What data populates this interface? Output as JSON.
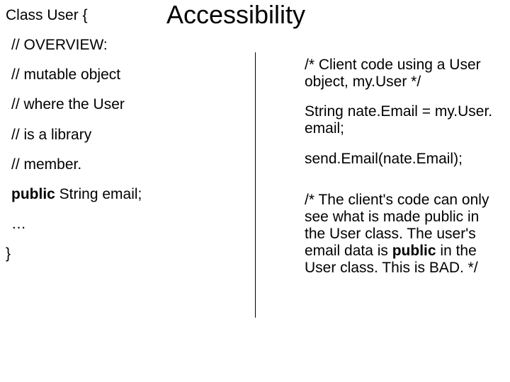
{
  "title": "Accessibility",
  "left": {
    "l1": "Class User {",
    "l2": "// OVERVIEW:",
    "l3": "// mutable object",
    "l4": "// where the User",
    "l5": "// is a library",
    "l6": "// member.",
    "l7_pre": "public",
    "l7_post": " String email;",
    "l8": "…",
    "l9": "}"
  },
  "right": {
    "r1": "/* Client code using a User object, my.User */",
    "r2": "String nate.Email = my.User. email;",
    "r3": "send.Email(nate.Email);",
    "r4a": "/*  The client's code can only see what is made public in the User class. The user's email data is ",
    "r4b": "public",
    "r4c": " in the User class. This is BAD.  */"
  }
}
